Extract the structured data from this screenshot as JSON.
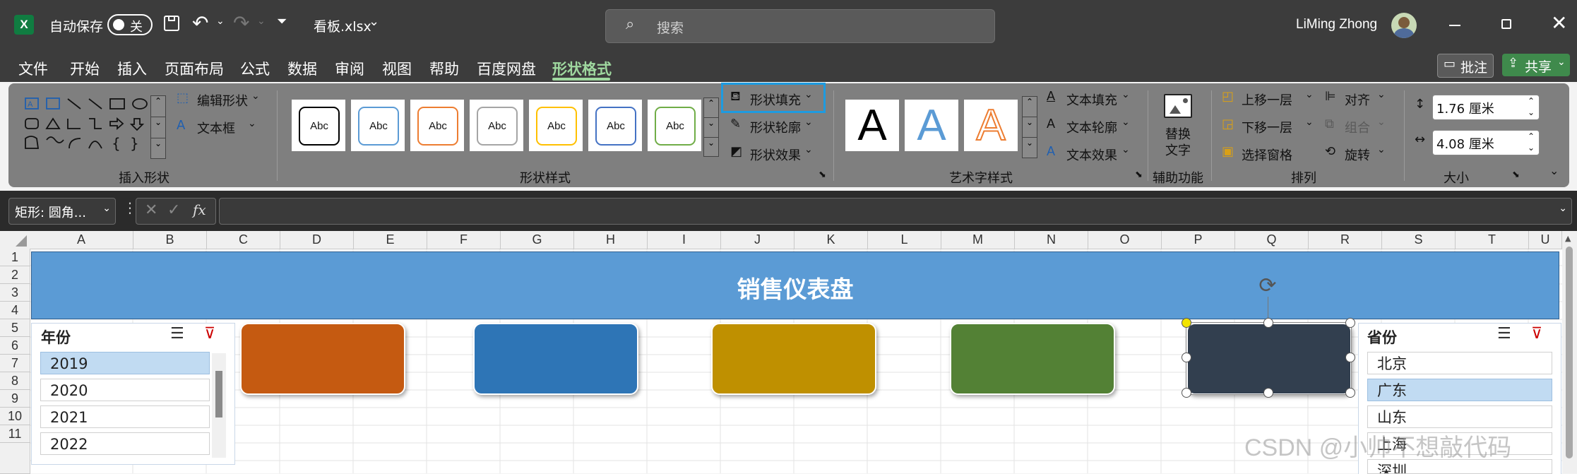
{
  "titlebar": {
    "autosave_label": "自动保存",
    "autosave_state": "关",
    "filename": "看板.xlsx",
    "search_placeholder": "搜索",
    "user_name": "LiMing Zhong"
  },
  "menu": {
    "items": [
      "文件",
      "开始",
      "插入",
      "页面布局",
      "公式",
      "数据",
      "审阅",
      "视图",
      "帮助",
      "百度网盘",
      "形状格式"
    ],
    "active": "形状格式",
    "comment_button": "批注",
    "share_button": "共享"
  },
  "ribbon": {
    "insert_shape": {
      "edit_shape": "编辑形状",
      "textbox": "文本框",
      "label": "插入形状"
    },
    "shape_styles": {
      "thumb_label": "Abc",
      "fill": "形状填充",
      "outline": "形状轮廓",
      "effects": "形状效果",
      "label": "形状样式",
      "thumb_colors": [
        "#000000",
        "#5b9bd5",
        "#ed7d31",
        "#a5a5a5",
        "#ffc000",
        "#4472c4",
        "#70ad47"
      ]
    },
    "wordart": {
      "letter": "A",
      "text_fill": "文本填充",
      "text_outline": "文本轮廓",
      "text_effects": "文本效果",
      "label": "艺术字样式"
    },
    "accessibility": {
      "alt_text_line1": "替换",
      "alt_text_line2": "文字",
      "label": "辅助功能"
    },
    "arrange": {
      "bring_forward": "上移一层",
      "send_backward": "下移一层",
      "selection_pane": "选择窗格",
      "align": "对齐",
      "group": "组合",
      "rotate": "旋转",
      "label": "排列"
    },
    "size": {
      "height": "1.76 厘米",
      "width": "4.08 厘米",
      "label": "大小"
    }
  },
  "formula_bar": {
    "name_box": "矩形: 圆角...",
    "fx": "fx",
    "formula": ""
  },
  "sheet": {
    "columns": [
      "A",
      "B",
      "C",
      "D",
      "E",
      "F",
      "G",
      "H",
      "I",
      "J",
      "K",
      "L",
      "M",
      "N",
      "O",
      "P",
      "Q",
      "R",
      "S",
      "T",
      "U"
    ],
    "rows": [
      "1",
      "2",
      "3",
      "4",
      "5",
      "6",
      "7",
      "8",
      "9",
      "10",
      "11"
    ],
    "banner_title": "销售仪表盘",
    "banner_color": "#5b9bd5",
    "year_slicer": {
      "title": "年份",
      "items": [
        "2019",
        "2020",
        "2021",
        "2022"
      ],
      "selected": "2019"
    },
    "province_slicer": {
      "title": "省份",
      "items": [
        "北京",
        "广东",
        "山东",
        "上海",
        "深圳"
      ],
      "selected": "广东"
    },
    "cards": [
      {
        "color": "#c55a11"
      },
      {
        "color": "#2e75b6"
      },
      {
        "color": "#bf9000"
      },
      {
        "color": "#538135"
      },
      {
        "color": "#323f4f"
      }
    ]
  },
  "watermark": "CSDN @小帅不想敲代码"
}
